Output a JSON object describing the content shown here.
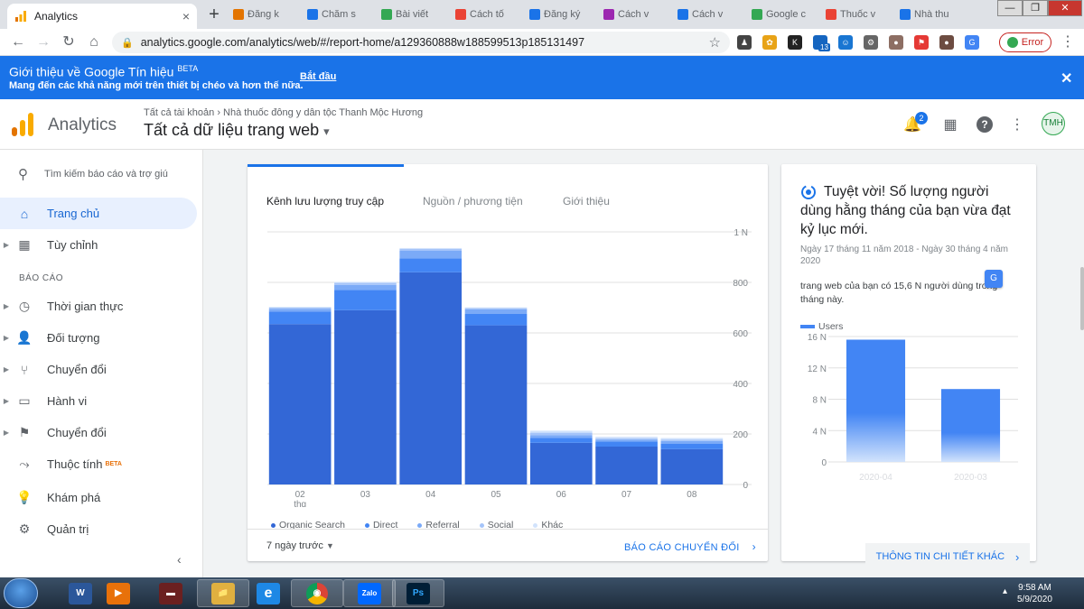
{
  "browser": {
    "tab_title": "Analytics",
    "tab_close": "×",
    "new_tab": "+",
    "bg_tabs": [
      "Đăng k",
      "Chăm s",
      "Bài viết",
      "Cách tố",
      "Đăng ký",
      "Cách v",
      "Cách v",
      "Google c",
      "Thuốc v",
      "Nhà thu"
    ],
    "window_controls": [
      "—",
      "❐",
      "✕"
    ],
    "url": "analytics.google.com/analytics/web/#/report-home/a129360888w188599513p185131497",
    "extension_badge": "13",
    "error_label": "Error",
    "menu": "⋮"
  },
  "banner": {
    "title": "Giới thiệu về Google Tín hiệu",
    "beta": "BETA",
    "subtitle": "Mang đến các khả năng mới trên thiết bị chéo và hơn thế nữa.",
    "cta": "Bắt đầu",
    "close": "✕"
  },
  "header": {
    "brand": "Analytics",
    "breadcrumb": "Tất cả tài khoản  ›  Nhà thuốc đông y dân tộc Thanh Mộc Hương",
    "property": "Tất cả dữ liệu trang web",
    "dropdown_glyph": "▾",
    "notif_count": "2",
    "apps_glyph": "▦",
    "help_glyph": "?",
    "more_glyph": "⋮",
    "avatar_text": "TMH"
  },
  "sidebar": {
    "search_placeholder": "Tìm kiếm báo cáo và trợ giú",
    "section_label": "BÁO CÁO",
    "items": [
      {
        "label": "Trang chủ"
      },
      {
        "label": "Tùy chỉnh"
      },
      {
        "label": "Thời gian thực"
      },
      {
        "label": "Đối tượng"
      },
      {
        "label": "Chuyển đổi"
      },
      {
        "label": "Hành vi"
      },
      {
        "label": "Chuyển đổi"
      },
      {
        "label": "Thuộc tính",
        "badge": "BETA"
      },
      {
        "label": "Khám phá"
      },
      {
        "label": "Quản trị"
      }
    ],
    "collapse": "‹"
  },
  "traffic_card": {
    "tabs": [
      "Kênh lưu lượng truy cập",
      "Nguồn / phương tiện",
      "Giới thiệu"
    ],
    "footer_left": "7 ngày trước",
    "footer_right": "BÁO CÁO CHUYỂN ĐỔI"
  },
  "insight_card": {
    "title": "Tuyệt vời! Số lượng người dùng hằng tháng của bạn vừa đạt kỷ lục mới.",
    "date_range": "Ngày 17 tháng 11 năm 2018 - Ngày 30 tháng 4 năm 2020",
    "body": "trang web của bạn có 15,6 N người dùng trong tháng này.",
    "button": "THÔNG TIN CHI TIẾT KHÁC"
  },
  "colors": {
    "organic": "#3367d6",
    "direct": "#4285f4",
    "referral": "#7baaf7",
    "social": "#a5c4f9",
    "other": "#d2e3fc",
    "accent": "#1a73e8"
  },
  "chart_data": [
    {
      "type": "bar",
      "stacked": true,
      "categories": [
        "02 thg",
        "03",
        "04",
        "05",
        "06",
        "07",
        "08"
      ],
      "series": [
        {
          "name": "Organic Search",
          "values": [
            635,
            690,
            840,
            630,
            165,
            150,
            140
          ]
        },
        {
          "name": "Direct",
          "values": [
            50,
            80,
            55,
            45,
            20,
            20,
            22
          ]
        },
        {
          "name": "Referral",
          "values": [
            10,
            20,
            30,
            18,
            10,
            7,
            10
          ]
        },
        {
          "name": "Social",
          "values": [
            5,
            8,
            8,
            5,
            10,
            6,
            6
          ]
        },
        {
          "name": "Khác",
          "values": [
            3,
            4,
            3,
            3,
            8,
            6,
            6
          ]
        }
      ],
      "yticks": [
        "0",
        "200",
        "400",
        "600",
        "800",
        "1 N"
      ],
      "ylim": [
        0,
        1000
      ],
      "legend_position": "bottom",
      "grid": true
    },
    {
      "type": "bar",
      "categories": [
        "2020-04",
        "2020-03"
      ],
      "series": [
        {
          "name": "Users",
          "values": [
            15.6,
            9.3
          ]
        }
      ],
      "yticks": [
        "0",
        "4 N",
        "8 N",
        "12 N",
        "16 N"
      ],
      "ylim": [
        0,
        16
      ],
      "legend_position": "top",
      "grid": true
    }
  ],
  "taskbar": {
    "apps": [
      "W",
      "▶",
      "▬",
      "📁",
      "e",
      "◉",
      "Zalo",
      "Ps"
    ],
    "time": "9:58 AM",
    "date": "5/9/2020",
    "tray": "▴"
  }
}
